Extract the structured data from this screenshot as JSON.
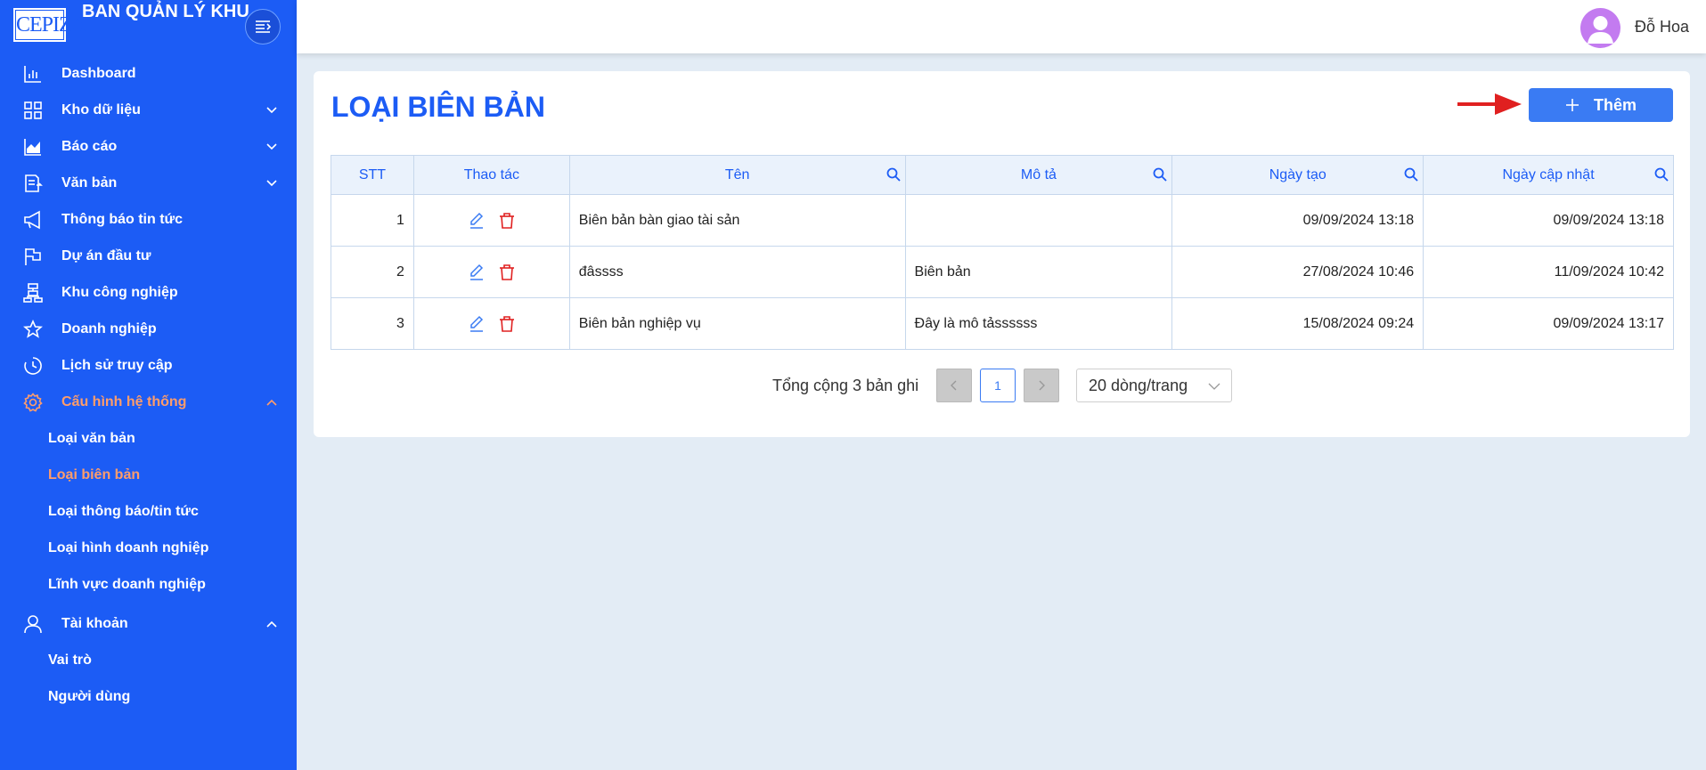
{
  "app": {
    "logo_text": "CEPIZA",
    "title": "BAN QUẢN LÝ KHU CHẾ XUẤT KHU CN"
  },
  "sidebar": {
    "items": [
      {
        "label": "Dashboard",
        "icon": "chart-bar-icon",
        "chevron": ""
      },
      {
        "label": "Kho dữ liệu",
        "icon": "grid-icon",
        "chevron": "down"
      },
      {
        "label": "Báo cáo",
        "icon": "area-chart-icon",
        "chevron": "down"
      },
      {
        "label": "Văn bản",
        "icon": "document-icon",
        "chevron": "down"
      },
      {
        "label": "Thông báo tin tức",
        "icon": "megaphone-icon",
        "chevron": ""
      },
      {
        "label": "Dự án đầu tư",
        "icon": "flag-icon",
        "chevron": ""
      },
      {
        "label": "Khu công nghiệp",
        "icon": "cluster-icon",
        "chevron": ""
      },
      {
        "label": "Doanh nghiệp",
        "icon": "star-icon",
        "chevron": ""
      },
      {
        "label": "Lịch sử truy cập",
        "icon": "history-icon",
        "chevron": ""
      },
      {
        "label": "Cấu hình hệ thống",
        "icon": "gear-icon",
        "chevron": "up",
        "active": true
      }
    ],
    "config_sub": [
      "Loại văn bản",
      "Loại biên bản",
      "Loại thông báo/tin tức",
      "Loại hình doanh nghiệp",
      "Lĩnh vực doanh nghiệp"
    ],
    "account": {
      "label": "Tài khoản",
      "icon": "user-icon",
      "chevron": "up"
    },
    "account_sub": [
      "Vai trò",
      "Người dùng"
    ]
  },
  "header": {
    "user_name": "Đỗ Hoa"
  },
  "page": {
    "title": "LOẠI BIÊN BẢN",
    "add_label": "Thêm"
  },
  "table": {
    "columns": [
      "STT",
      "Thao tác",
      "Tên",
      "Mô tả",
      "Ngày tạo",
      "Ngày cập nhật"
    ],
    "rows": [
      {
        "stt": "1",
        "ten": "Biên bản bàn giao tài sản",
        "mo_ta": "",
        "ngay_tao": "09/09/2024 13:18",
        "ngay_cap_nhat": "09/09/2024 13:18"
      },
      {
        "stt": "2",
        "ten": "đâssss",
        "mo_ta": "Biên bản",
        "ngay_tao": "27/08/2024 10:46",
        "ngay_cap_nhat": "11/09/2024 10:42"
      },
      {
        "stt": "3",
        "ten": "Biên bản nghiệp vụ",
        "mo_ta": "Đây là mô tảssssss",
        "ngay_tao": "15/08/2024 09:24",
        "ngay_cap_nhat": "09/09/2024 13:17"
      }
    ]
  },
  "pagination": {
    "total_text": "Tổng cộng 3 bản ghi",
    "current_page": "1",
    "page_size": "20 dòng/trang"
  },
  "colors": {
    "sidebar_bg": "#1c5cf5",
    "active": "#ff9d6b",
    "primary": "#3a7bf3",
    "delete": "#e02020"
  }
}
